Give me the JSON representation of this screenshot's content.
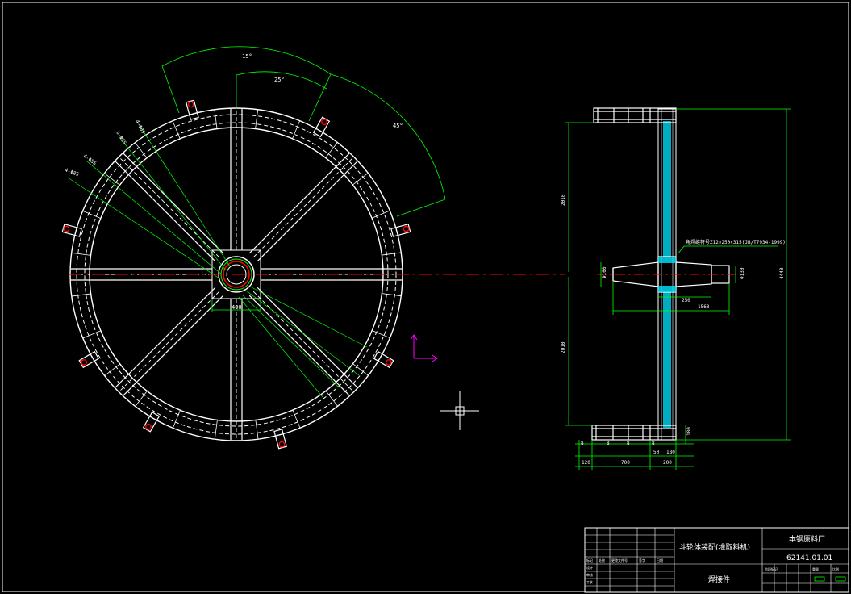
{
  "drawing": {
    "background": "#000000",
    "colors": {
      "outline": "#ffffff",
      "dimension": "#00ff00",
      "centerline": "#ff0000",
      "hidden": "#ffffff",
      "weld_fill": "#00e5ff",
      "ucs": "#ff00ff"
    }
  },
  "front_view": {
    "angle_labels": [
      "15°",
      "25°",
      "45°"
    ],
    "leader_labels": [
      "4-Φ85",
      "6-Φ85",
      "4-Φ85",
      "4-Φ85"
    ],
    "hub_dimension": "400"
  },
  "side_view": {
    "label_upper_height": "2010",
    "label_lower_height": "2010",
    "label_overall_height": "4440",
    "note": "角焊缝符号Z12×250×315(JB/T7934-1999)",
    "label_hub_left": "Φ160",
    "label_hub_right": "Φ130",
    "label_250": "250",
    "label_1563": "1563",
    "label_180": "180",
    "bottom_dims": [
      "8",
      "8",
      "8",
      "8",
      "120",
      "700",
      "200",
      "50",
      "180"
    ]
  },
  "title_block": {
    "title": "斗轮体装配(堆取料机)",
    "company": "本钢原料厂",
    "drawing_number": "62141.01.01",
    "material": "焊接件",
    "small_labels": [
      "标记",
      "处数",
      "更改文件号",
      "签字",
      "日期",
      "设计",
      "审核",
      "工艺",
      "阶段标记",
      "重量",
      "比例"
    ]
  }
}
